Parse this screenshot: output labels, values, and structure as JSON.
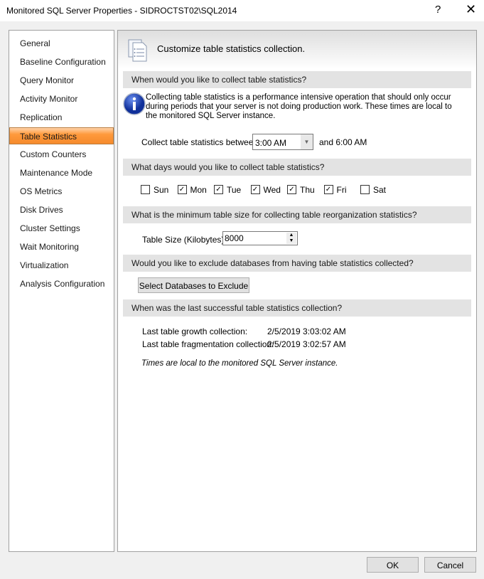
{
  "window": {
    "title": "Monitored SQL Server Properties - SIDROCTST02\\SQL2014",
    "help": "?",
    "close": "✕"
  },
  "sidebar": {
    "items": [
      {
        "label": "General"
      },
      {
        "label": "Baseline Configuration"
      },
      {
        "label": "Query Monitor"
      },
      {
        "label": "Activity Monitor"
      },
      {
        "label": "Replication"
      },
      {
        "label": "Table Statistics",
        "selected": true
      },
      {
        "label": "Custom Counters"
      },
      {
        "label": "Maintenance Mode"
      },
      {
        "label": "OS Metrics"
      },
      {
        "label": "Disk Drives"
      },
      {
        "label": "Cluster Settings"
      },
      {
        "label": "Wait Monitoring"
      },
      {
        "label": "Virtualization"
      },
      {
        "label": "Analysis Configuration"
      }
    ]
  },
  "panel": {
    "header": "Customize table statistics collection.",
    "s1": {
      "title": "When would you like to collect table statistics?",
      "info": "Collecting table statistics is a performance intensive operation that should only occur during periods that your server is not doing production work.  These times are local to the monitored SQL Server instance.",
      "between_label": "Collect table statistics between",
      "start": "3:00 AM",
      "end": "and 6:00 AM"
    },
    "s2": {
      "title": "What days would you like to collect table statistics?",
      "days": [
        {
          "label": "Sun",
          "checked": false
        },
        {
          "label": "Mon",
          "checked": true
        },
        {
          "label": "Tue",
          "checked": true
        },
        {
          "label": "Wed",
          "checked": true
        },
        {
          "label": "Thu",
          "checked": true
        },
        {
          "label": "Fri",
          "checked": true
        },
        {
          "label": "Sat",
          "checked": false
        }
      ]
    },
    "s3": {
      "title": "What is the minimum table size for collecting table reorganization statistics?",
      "label": "Table Size (Kilobytes):",
      "value": "8000"
    },
    "s4": {
      "title": "Would you like to exclude databases from having table statistics collected?",
      "button": "Select Databases to Exclude"
    },
    "s5": {
      "title": "When was the last successful table statistics collection?",
      "growth_label": "Last table growth collection:",
      "growth_value": "2/5/2019 3:03:02 AM",
      "frag_label": "Last table fragmentation collection:",
      "frag_value": "2/5/2019 3:02:57 AM",
      "note": "Times are local to the monitored SQL Server instance."
    }
  },
  "footer": {
    "ok": "OK",
    "cancel": "Cancel"
  }
}
